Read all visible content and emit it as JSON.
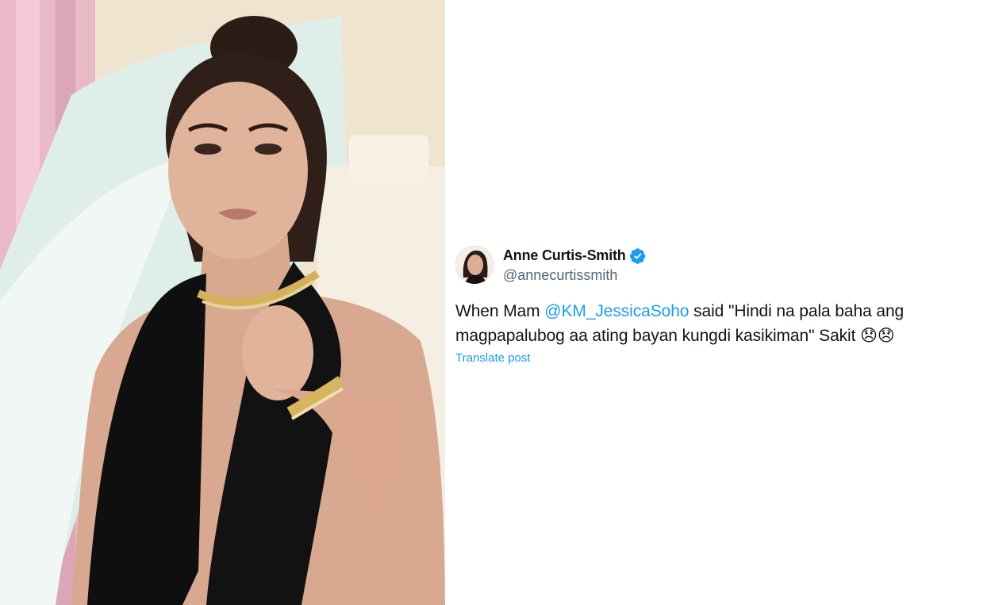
{
  "colors": {
    "accent": "#1d9bf0",
    "text": "#0f1419",
    "muted": "#536471"
  },
  "photo": {
    "description_icon": "portrait-photo"
  },
  "tweet": {
    "author": {
      "display_name": "Anne Curtis-Smith",
      "handle": "@annecurtissmith",
      "verified_icon": "verified-badge-icon"
    },
    "text": {
      "before_mention": "When Mam ",
      "mention": "@KM_JessicaSoho",
      "after_mention": " said \"Hindi na pala baha ang magpapalubog aa ating bayan kungdi kasikiman\" Sakit ",
      "emojis": "😞😞"
    },
    "translate_label": "Translate post"
  }
}
